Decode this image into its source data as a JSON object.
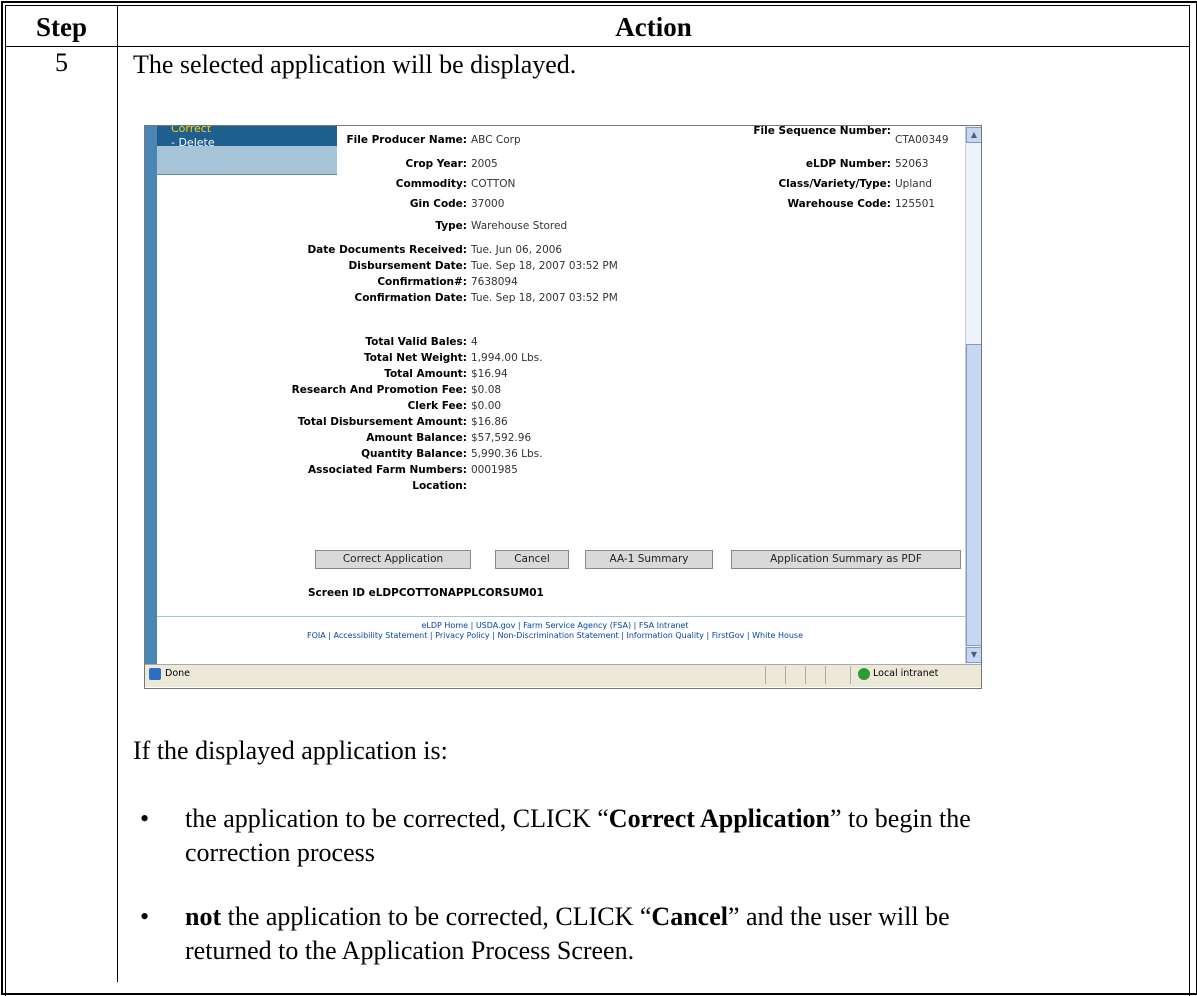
{
  "header": {
    "step": "Step",
    "action": "Action"
  },
  "row": {
    "step": "5",
    "intro": "The selected application will be displayed."
  },
  "screenshot": {
    "left_menu": {
      "correct": "Correct",
      "delete": "- Delete"
    },
    "fields_left": [
      {
        "label": "File Producer Name:",
        "value": "ABC Corp"
      },
      {
        "label": "Crop Year:",
        "value": "2005"
      },
      {
        "label": "Commodity:",
        "value": "COTTON"
      },
      {
        "label": "Gin Code:",
        "value": "37000"
      },
      {
        "label": "Type:",
        "value": "Warehouse Stored"
      }
    ],
    "fields_right": [
      {
        "label": "File Sequence Number:",
        "value": "CTA00349"
      },
      {
        "label": "eLDP Number:",
        "value": "52063"
      },
      {
        "label": "Class/Variety/Type:",
        "value": "Upland"
      },
      {
        "label": "Warehouse Code:",
        "value": "125501"
      }
    ],
    "dates": [
      {
        "label": "Date Documents Received:",
        "value": "Tue. Jun 06, 2006"
      },
      {
        "label": "Disbursement Date:",
        "value": "Tue. Sep 18, 2007 03:52 PM"
      },
      {
        "label": "Confirmation#:",
        "value": "7638094"
      },
      {
        "label": "Confirmation Date:",
        "value": "Tue. Sep 18, 2007 03:52 PM"
      }
    ],
    "totals": [
      {
        "label": "Total Valid Bales:",
        "value": "4"
      },
      {
        "label": "Total Net Weight:",
        "value": "1,994.00  Lbs."
      },
      {
        "label": "Total Amount:",
        "value": "$16.94"
      },
      {
        "label": "Research And Promotion Fee:",
        "value": "$0.08"
      },
      {
        "label": "Clerk Fee:",
        "value": "$0.00"
      },
      {
        "label": "Total Disbursement Amount:",
        "value": "$16.86"
      },
      {
        "label": "Amount Balance:",
        "value": "$57,592.96"
      },
      {
        "label": "Quantity Balance:",
        "value": "5,990.36  Lbs."
      },
      {
        "label": "Associated Farm Numbers:",
        "value": "0001985"
      },
      {
        "label": "Location:",
        "value": ""
      }
    ],
    "buttons": {
      "correct": "Correct Application",
      "cancel": "Cancel",
      "aa1": "AA-1 Summary",
      "pdf": "Application Summary as PDF"
    },
    "screen_id": "Screen ID eLDPCOTTONAPPLCORSUM01",
    "footer_line1": "eLDP Home | USDA.gov | Farm Service Agency (FSA) | FSA Intranet",
    "footer_line2": "FOIA | Accessibility Statement | Privacy Policy | Non-Discrimination Statement | Information Quality | FirstGov | White House",
    "status": "Done",
    "zone": "Local intranet"
  },
  "after": {
    "question": "If the displayed application is:",
    "b1_pre": "the application to be corrected, CLICK “",
    "b1_bold": "Correct Application",
    "b1_post": "” to begin the",
    "b1_line2": "correction process",
    "b2_bold": "not",
    "b2_mid": " the application to be corrected, CLICK “",
    "b2_bold2": "Cancel",
    "b2_post": "” and the user will be",
    "b2_line2": "returned to the Application Process Screen."
  }
}
